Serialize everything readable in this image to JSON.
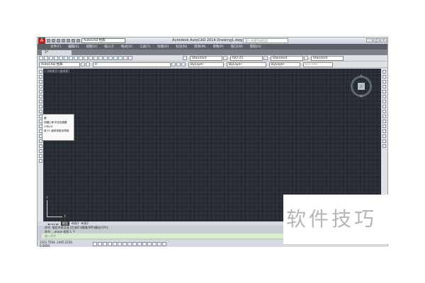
{
  "titlebar": {
    "workspace": "AutoCAD 经典",
    "title": "Autodesk AutoCAD 2014  Drawing1.dwg",
    "search_placeholder": "键入关键字或短语",
    "logo": "A"
  },
  "menu": [
    "文件(F)",
    "编辑(E)",
    "视图(V)",
    "插入(I)",
    "格式(O)",
    "工具(T)",
    "绘图(D)",
    "标注(N)",
    "修改(M)",
    "参数(P)",
    "窗口(W)",
    "帮助(H)"
  ],
  "doc_tab": "2*",
  "styles": {
    "text_style": "Standard",
    "dim_style": "ISO-25",
    "table_style": "Standard",
    "mleader_style": "Standard"
  },
  "layers": {
    "workspace": "AutoCAD 经典",
    "layer": "0",
    "color": "ByLayer",
    "linetype": "ByLayer",
    "lineweight": "ByLayer",
    "plotstyle": "ByColor"
  },
  "viewport_label": "[-][俯视][二维线框]",
  "viewcube": {
    "face": "上",
    "north": "北",
    "south": "南"
  },
  "ucs": {
    "x": "X",
    "y": "Y"
  },
  "tooltip": {
    "title": "圆",
    "desc": "用圆心和半径创建圆",
    "command": "CIRCLE",
    "help": "按 F1 键获得更多帮助"
  },
  "layout_tabs": [
    "模型",
    "布局1",
    "布局2"
  ],
  "command_history": [
    "命令: 指定对角点或 [栏选(F)/圈围(WP)/圈交(CP)]:",
    "命令: _.erase 找到 1 个"
  ],
  "command_placeholder": "键入命令",
  "status": {
    "coords": "1321.7504, 2445.2256, 0.0000"
  },
  "watermark": "软件技巧"
}
